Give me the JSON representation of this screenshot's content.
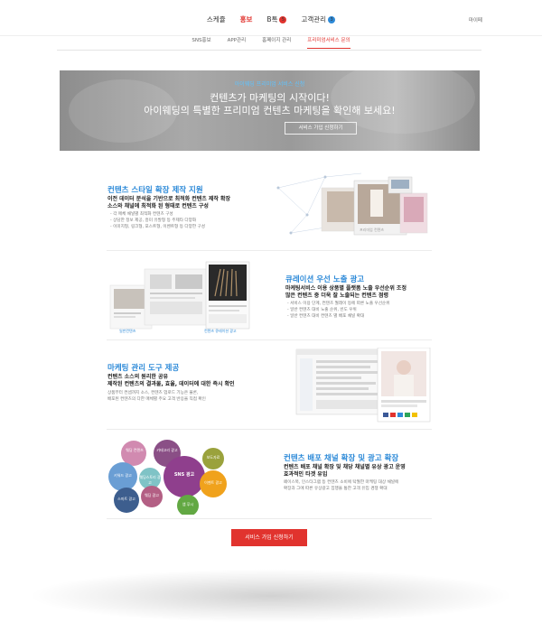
{
  "nav": {
    "items": [
      "스케쥴",
      "홍보",
      "B톡",
      "고객관리"
    ],
    "btalk_badge": "5",
    "customer_badge": "3",
    "mypage": "마이페"
  },
  "subnav": [
    "SNS홍보",
    "APP관리",
    "홈페이지 관리",
    "프리미엄서비스 문의"
  ],
  "hero": {
    "small": "아이웨딩 프리미엄 서비스 신청",
    "line1": "컨텐츠가 마케팅의 시작이다!",
    "line2": "아이웨딩의 특별한 프리미엄 컨텐츠 마케팅을 확인해 보세요!",
    "button": "서비스 가입 신청하기"
  },
  "sections": [
    {
      "title": "컨텐츠 스타일 확장 제작 지원",
      "head1": "이전 데이터 분석을 기반으로 최적화 컨텐츠 제작 확장",
      "head2": "소스와 채널에 최적화 된 형태로 컨텐츠 구성",
      "list": [
        "- 각 매체 채널별 최적화 컨텐츠 구성",
        "- 상담한 정보 제공, 흥미 유발형 등 주제타 다양화",
        "- 이미지형, 링크형, 포스트형, 이벤트형 등 다양한 구성"
      ]
    },
    {
      "title": "큐레이션 우선 노출 광고",
      "head1": "마케팅서비스 이용 상품별 플랫폼 노출 우선순위 조정",
      "head2": "많은 컨텐츠 중 더욱 잘 노출되는 컨텐츠 점령",
      "list": [
        "- 서비스 이용 단계, 컨텐츠 월래이 등에 따른 노출 우선순위",
        "- 일반 컨텐츠 대비 노출 순위, 빈도 우위",
        "- 일반 컨텐츠 대비 컨텐츠 별 배포 채널 확대"
      ]
    },
    {
      "title": "마케팅 관리 도구 제공",
      "head1": "컨텐츠 소스의 원리한 공유",
      "head2": "제작된 컨텐츠의 결과물, 효율, 데이터에 대한 즉시 확인",
      "list": [
        "상품부터 컨셉까지 소스, 컨텐츠 업로드 기능은 물론,",
        "배포된 컨텐츠의 다한 매체별 주요 고객 반응을 직접 확인"
      ]
    },
    {
      "title": "컨텐츠 배포 채널 확장 및 광고 확장",
      "head1": "컨텐츠 배포 채널 확장 및 채당 채널별 유상 광고 운영",
      "head2": "효과적인 타겟 유입",
      "list": [
        "페이스북, 인스타그램 등 컨텐츠 소비에 탁월한 마케팅 대상 채널에",
        "확장과 그에 따른 유상광고 집행을 통한 고객 유입 경쟁 확대"
      ]
    }
  ],
  "fig1": {
    "label": "프리미엄 컨텐츠"
  },
  "fig2": {
    "label_left": "일반컨텐츠",
    "label_right": "컨텐츠 큐레이션 광고"
  },
  "bubbles": {
    "b1": "웨딩 컨텐츠",
    "b2": "카테고리 광고",
    "b3": "이벤트 광고",
    "b4": "SNS 광고",
    "b5": "웨딩 광고",
    "b6": "보도자료",
    "b7": "키워드 광고",
    "b8": "웨딩스토리 광고",
    "b9": "스마트 광고",
    "b10": "앱 푸시"
  },
  "cta": "서비스 가입 신청하기",
  "colors": {
    "accent": "#e1332e",
    "title_blue": "#2d8ad8"
  }
}
